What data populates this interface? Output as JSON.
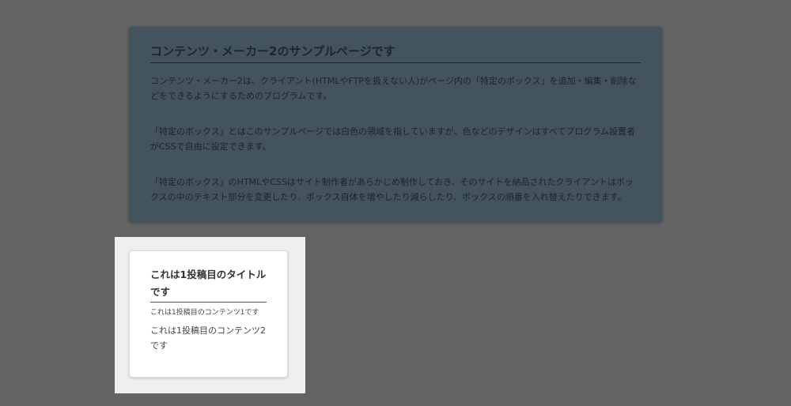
{
  "intro": {
    "title": "コンテンツ・メーカー2のサンプルページです",
    "paragraphs": [
      "コンテンツ・メーカー2は、クライアント(HTMLやFTPを扱えない人)がページ内の「特定のボックス」を追加・編集・削除などをできるようにするためのプログラムです。",
      "「特定のボックス」とはこのサンプルページでは白色の領域を指していますが、色などのデザインはすべてプログラム設置者がCSSで自由に設定できます。",
      "「特定のボックス」のHTMLやCSSはサイト制作者があらかじめ制作しておき、そのサイトを納品されたクライアントはボックスの中のテキスト部分を変更したり、ボックス自体を増やしたり減らしたり、ボックスの順番を入れ替えたりできます。"
    ]
  },
  "post": {
    "title": "これは1投稿目のタイトルです",
    "content1": "これは1投稿目のコンテンツ1です",
    "content2": "これは1投稿目のコンテンツ2です"
  },
  "colors": {
    "overlay": "#636363",
    "intro_box": "#44545f",
    "highlight": "#efefef",
    "card": "#ffffff"
  }
}
